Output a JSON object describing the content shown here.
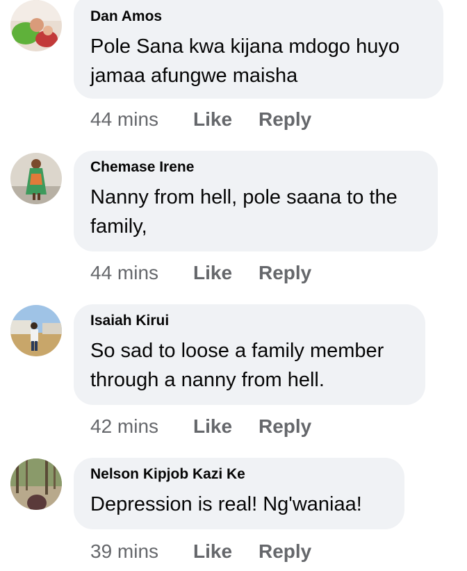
{
  "comments": [
    {
      "author": "Dan Amos",
      "text": "Pole Sana kwa  kijana mdogo huyo jamaa afungwe maisha",
      "time": "44 mins",
      "like_label": "Like",
      "reply_label": "Reply"
    },
    {
      "author": "Chemase Irene",
      "text": "Nanny from hell, pole saana to the family,",
      "time": "44 mins",
      "like_label": "Like",
      "reply_label": "Reply"
    },
    {
      "author": "Isaiah Kirui",
      "text": "So sad to loose a family member through a nanny from hell.",
      "time": "42 mins",
      "like_label": "Like",
      "reply_label": "Reply"
    },
    {
      "author": "Nelson Kipjob Kazi Ke",
      "text": "Depression is real! Ng'waniaa!",
      "time": "39 mins",
      "like_label": "Like",
      "reply_label": "Reply"
    }
  ],
  "colors": {
    "bubble": "#f0f2f5",
    "meta_text": "#65676b",
    "text": "#050505"
  }
}
